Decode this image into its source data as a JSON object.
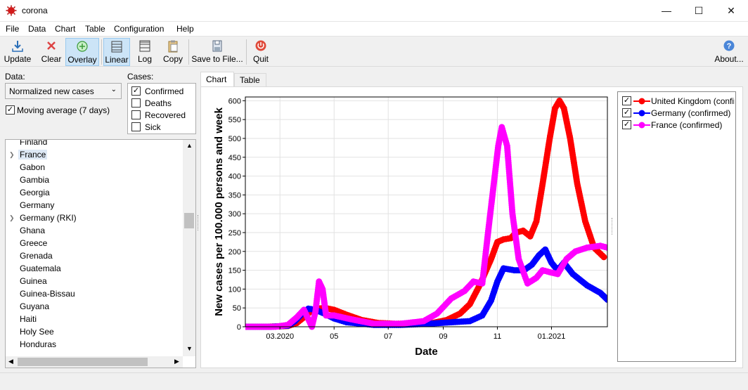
{
  "window": {
    "title": "corona",
    "minimize": "—",
    "maximize": "☐",
    "close": "✕"
  },
  "menu": [
    "File",
    "Data",
    "Chart",
    "Table",
    "Configuration",
    "Help"
  ],
  "toolbar": {
    "update": "Update",
    "clear": "Clear",
    "overlay": "Overlay",
    "linear": "Linear",
    "log": "Log",
    "copy": "Copy",
    "save": "Save to File...",
    "quit": "Quit",
    "about": "About..."
  },
  "left": {
    "data_label": "Data:",
    "data_value": "Normalized new cases",
    "moving_average": "Moving average (7 days)",
    "cases_label": "Cases:",
    "cases": [
      {
        "label": "Confirmed",
        "checked": true
      },
      {
        "label": "Deaths",
        "checked": false
      },
      {
        "label": "Recovered",
        "checked": false
      },
      {
        "label": "Sick",
        "checked": false
      }
    ],
    "countries": [
      "Finland",
      "France",
      "Gabon",
      "Gambia",
      "Georgia",
      "Germany",
      "Germany (RKI)",
      "Ghana",
      "Greece",
      "Grenada",
      "Guatemala",
      "Guinea",
      "Guinea-Bissau",
      "Guyana",
      "Haiti",
      "Holy See",
      "Honduras"
    ],
    "selected_country": "France"
  },
  "tabs": {
    "chart": "Chart",
    "table": "Table"
  },
  "legend": [
    {
      "label": "United Kingdom (confirmed)",
      "color": "#ff0000"
    },
    {
      "label": "Germany (confirmed)",
      "color": "#0000ff"
    },
    {
      "label": "France (confirmed)",
      "color": "#ff00ff"
    }
  ],
  "chart_data": {
    "type": "line",
    "title": "",
    "xlabel": "Date",
    "ylabel": "New cases per 100.000 persons and week",
    "ylim": [
      0,
      610
    ],
    "xlim": [
      "2020-01-22",
      "2021-03-05"
    ],
    "yticks": [
      0,
      50,
      100,
      150,
      200,
      250,
      300,
      350,
      400,
      450,
      500,
      550,
      600
    ],
    "xticks": [
      {
        "date": "2020-03-01",
        "label": "03.2020"
      },
      {
        "date": "2020-05-01",
        "label": "05"
      },
      {
        "date": "2020-07-01",
        "label": "07"
      },
      {
        "date": "2020-09-01",
        "label": "09"
      },
      {
        "date": "2020-11-01",
        "label": "11"
      },
      {
        "date": "2021-01-01",
        "label": "01.2021"
      }
    ],
    "grid": true,
    "series": [
      {
        "name": "United Kingdom (confirmed)",
        "color": "#ff0000",
        "x": [
          "2020-01-22",
          "2020-02-15",
          "2020-03-10",
          "2020-03-20",
          "2020-03-28",
          "2020-04-05",
          "2020-04-12",
          "2020-04-20",
          "2020-05-01",
          "2020-05-15",
          "2020-06-01",
          "2020-06-20",
          "2020-07-10",
          "2020-08-01",
          "2020-08-20",
          "2020-09-05",
          "2020-09-20",
          "2020-10-01",
          "2020-10-12",
          "2020-10-25",
          "2020-11-01",
          "2020-11-08",
          "2020-11-16",
          "2020-11-22",
          "2020-11-30",
          "2020-12-08",
          "2020-12-15",
          "2020-12-22",
          "2020-12-30",
          "2021-01-05",
          "2021-01-10",
          "2021-01-15",
          "2021-01-22",
          "2021-01-30",
          "2021-02-08",
          "2021-02-18",
          "2021-03-01"
        ],
        "y": [
          0,
          0,
          2,
          10,
          25,
          42,
          48,
          50,
          45,
          32,
          18,
          10,
          8,
          9,
          10,
          18,
          35,
          60,
          110,
          180,
          225,
          232,
          235,
          250,
          255,
          240,
          280,
          380,
          500,
          580,
          600,
          580,
          500,
          380,
          280,
          210,
          185
        ]
      },
      {
        "name": "Germany (confirmed)",
        "color": "#0000ff",
        "x": [
          "2020-01-22",
          "2020-02-20",
          "2020-03-10",
          "2020-03-18",
          "2020-03-26",
          "2020-04-02",
          "2020-04-10",
          "2020-04-20",
          "2020-05-01",
          "2020-05-15",
          "2020-06-15",
          "2020-07-15",
          "2020-08-15",
          "2020-09-10",
          "2020-10-01",
          "2020-10-15",
          "2020-10-25",
          "2020-11-01",
          "2020-11-08",
          "2020-11-20",
          "2020-12-01",
          "2020-12-10",
          "2020-12-18",
          "2020-12-25",
          "2021-01-01",
          "2021-01-08",
          "2021-01-15",
          "2021-01-25",
          "2021-02-10",
          "2021-02-25",
          "2021-03-05"
        ],
        "y": [
          0,
          0,
          3,
          15,
          35,
          48,
          45,
          35,
          22,
          12,
          5,
          5,
          8,
          12,
          15,
          30,
          70,
          120,
          155,
          150,
          150,
          165,
          190,
          205,
          170,
          150,
          170,
          140,
          110,
          90,
          72
        ]
      },
      {
        "name": "France (confirmed)",
        "color": "#ff00ff",
        "x": [
          "2020-01-22",
          "2020-02-25",
          "2020-03-10",
          "2020-03-20",
          "2020-03-28",
          "2020-04-02",
          "2020-04-06",
          "2020-04-10",
          "2020-04-14",
          "2020-04-18",
          "2020-04-22",
          "2020-05-01",
          "2020-05-20",
          "2020-06-15",
          "2020-07-15",
          "2020-08-10",
          "2020-08-25",
          "2020-09-10",
          "2020-09-25",
          "2020-10-05",
          "2020-10-15",
          "2020-10-22",
          "2020-10-28",
          "2020-11-02",
          "2020-11-06",
          "2020-11-12",
          "2020-11-18",
          "2020-11-25",
          "2020-12-05",
          "2020-12-15",
          "2020-12-22",
          "2020-12-30",
          "2021-01-08",
          "2021-01-18",
          "2021-01-28",
          "2021-02-10",
          "2021-02-25",
          "2021-03-05"
        ],
        "y": [
          0,
          0,
          5,
          25,
          45,
          20,
          0,
          40,
          120,
          100,
          30,
          30,
          20,
          8,
          8,
          15,
          35,
          75,
          95,
          120,
          115,
          260,
          380,
          480,
          530,
          480,
          300,
          180,
          115,
          130,
          150,
          145,
          140,
          180,
          200,
          210,
          215,
          210
        ]
      }
    ]
  }
}
